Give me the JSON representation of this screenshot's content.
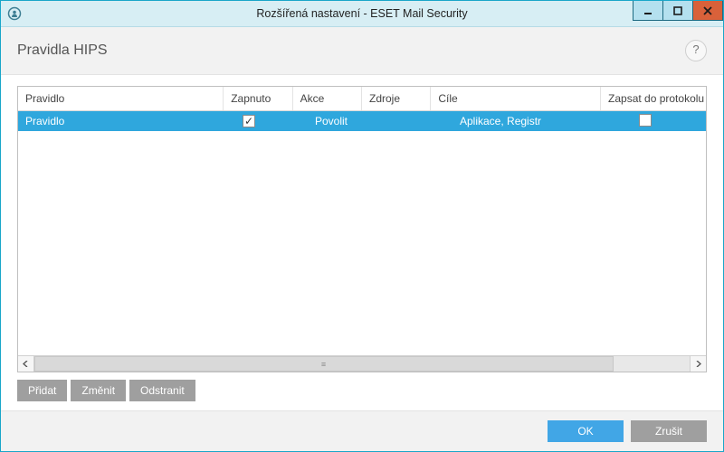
{
  "window": {
    "title": "Rozšířená nastavení - ESET Mail Security"
  },
  "header": {
    "page_title": "Pravidla HIPS",
    "help_label": "?"
  },
  "table": {
    "columns": {
      "rule": "Pravidlo",
      "enabled": "Zapnuto",
      "action": "Akce",
      "sources": "Zdroje",
      "targets": "Cíle",
      "log": "Zapsat do protokolu"
    },
    "rows": [
      {
        "rule": "Pravidlo",
        "enabled": true,
        "action": "Povolit",
        "sources": "",
        "targets": "Aplikace, Registr",
        "log": false,
        "selected": true
      }
    ]
  },
  "edit_buttons": {
    "add": "Přidat",
    "edit": "Změnit",
    "remove": "Odstranit"
  },
  "footer": {
    "ok": "OK",
    "cancel": "Zrušit"
  }
}
